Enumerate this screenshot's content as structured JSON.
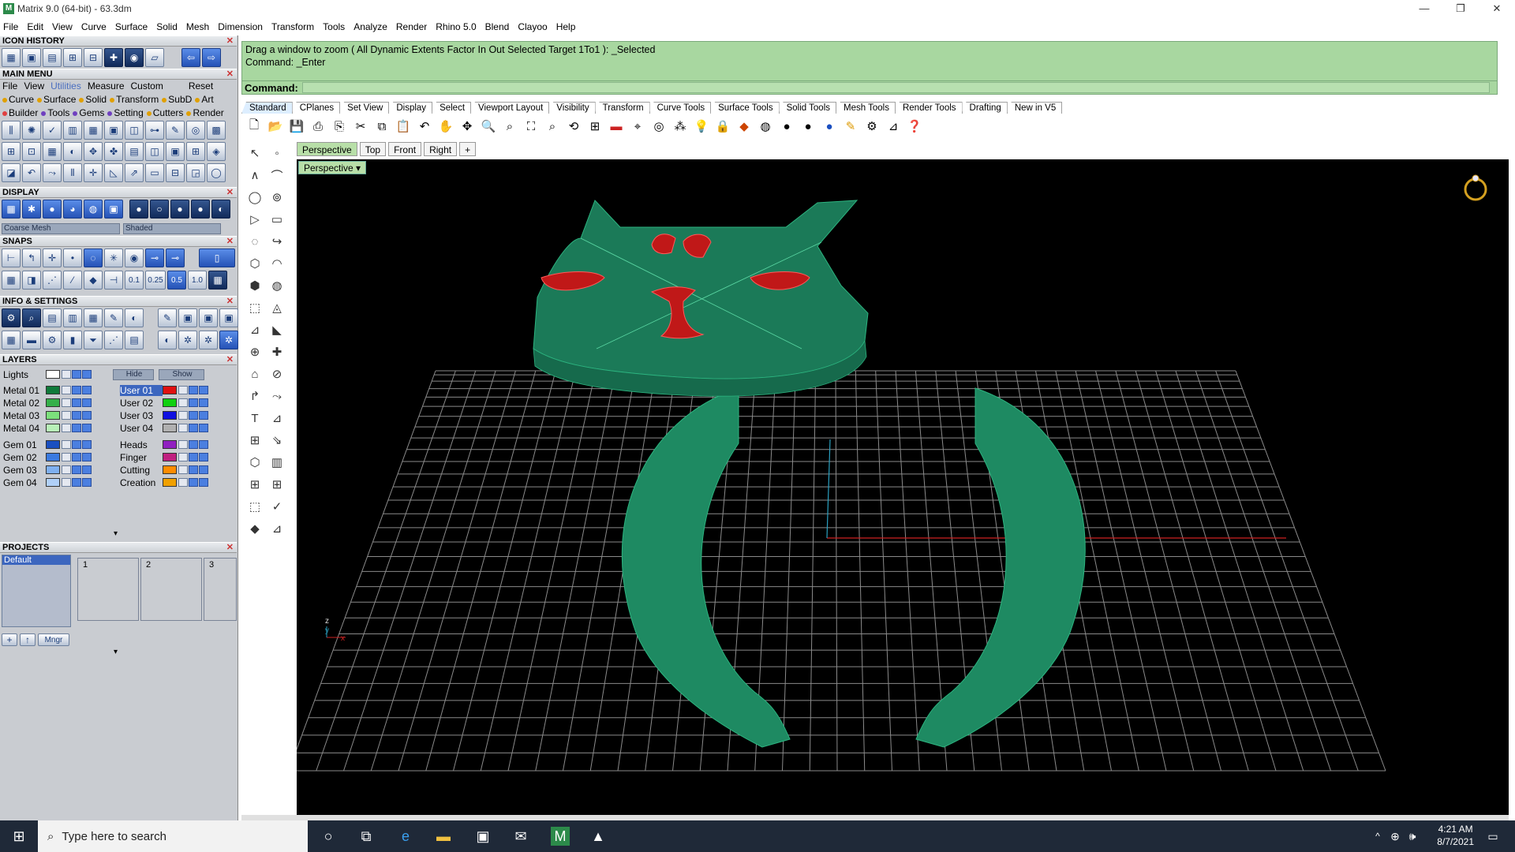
{
  "window": {
    "title": "Matrix 9.0 (64-bit) - 63.3dm",
    "app_icon": "M"
  },
  "menubar": [
    "File",
    "Edit",
    "View",
    "Curve",
    "Surface",
    "Solid",
    "Mesh",
    "Dimension",
    "Transform",
    "Tools",
    "Analyze",
    "Render",
    "Rhino 5.0",
    "Blend",
    "Clayoo",
    "Help"
  ],
  "left": {
    "icon_history": "ICON HISTORY",
    "main_menu": "MAIN MENU",
    "main_menu_items": [
      "File",
      "View",
      "Utilities",
      "Measure",
      "Custom",
      "Reset"
    ],
    "cat_row1": [
      "Curve",
      "Surface",
      "Solid",
      "Transform",
      "SubD",
      "Art"
    ],
    "cat_row2": [
      "Builder",
      "Tools",
      "Gems",
      "Setting",
      "Cutters",
      "Render"
    ],
    "display": "DISPLAY",
    "display_mesh": "Coarse Mesh",
    "display_mode": "Shaded",
    "snaps": "SNAPS",
    "snap_values": [
      "0.1",
      "0.25",
      "0.5",
      "1.0"
    ],
    "info": "INFO & SETTINGS",
    "layers": "LAYERS",
    "lights": "Lights",
    "hide": "Hide",
    "show": "Show",
    "layers_left": [
      {
        "name": "Metal 01",
        "color": "#0f7a3a"
      },
      {
        "name": "Metal 02",
        "color": "#34b04a"
      },
      {
        "name": "Metal 03",
        "color": "#7ce07c"
      },
      {
        "name": "Metal 04",
        "color": "#b8f0b8"
      },
      {
        "name": "Gem 01",
        "color": "#1a4fc0"
      },
      {
        "name": "Gem 02",
        "color": "#3a7ae0"
      },
      {
        "name": "Gem 03",
        "color": "#7fb0f0"
      },
      {
        "name": "Gem 04",
        "color": "#b0d0f8"
      }
    ],
    "layers_right": [
      {
        "name": "User 01",
        "color": "#e01010"
      },
      {
        "name": "User 02",
        "color": "#10d010"
      },
      {
        "name": "User 03",
        "color": "#1010e0"
      },
      {
        "name": "User 04",
        "color": "#b0b0b0"
      },
      {
        "name": "Heads",
        "color": "#9020c0"
      },
      {
        "name": "Finger",
        "color": "#c02080"
      },
      {
        "name": "Cutting",
        "color": "#ff8c00"
      },
      {
        "name": "Creation",
        "color": "#f0a000"
      }
    ],
    "projects": "PROJECTS",
    "project_default": "Default",
    "project_slots": [
      "1",
      "2",
      "3"
    ],
    "mngr": "Mngr"
  },
  "command": {
    "history_line1": "Drag a window to zoom ( All  Dynamic  Extents  Factor  In  Out  Selected  Target  1To1 ): _Selected",
    "history_line2": "Command: _Enter",
    "prompt": "Command:"
  },
  "tabs": [
    "Standard",
    "CPlanes",
    "Set View",
    "Display",
    "Select",
    "Viewport Layout",
    "Visibility",
    "Transform",
    "Curve Tools",
    "Surface Tools",
    "Solid Tools",
    "Mesh Tools",
    "Render Tools",
    "Drafting",
    "New in V5"
  ],
  "viewport_tabs": [
    "Perspective",
    "Top",
    "Front",
    "Right",
    "+"
  ],
  "viewport_name": "Perspective",
  "axis_labels": {
    "z": "z",
    "y": "y",
    "x": "x"
  },
  "taskbar": {
    "search_placeholder": "Type here to search",
    "time": "4:21 AM",
    "date": "8/7/2021"
  },
  "colors": {
    "model": "#1e9a6a",
    "accent_red": "#c01818",
    "command_bg": "#a8d7a0"
  }
}
